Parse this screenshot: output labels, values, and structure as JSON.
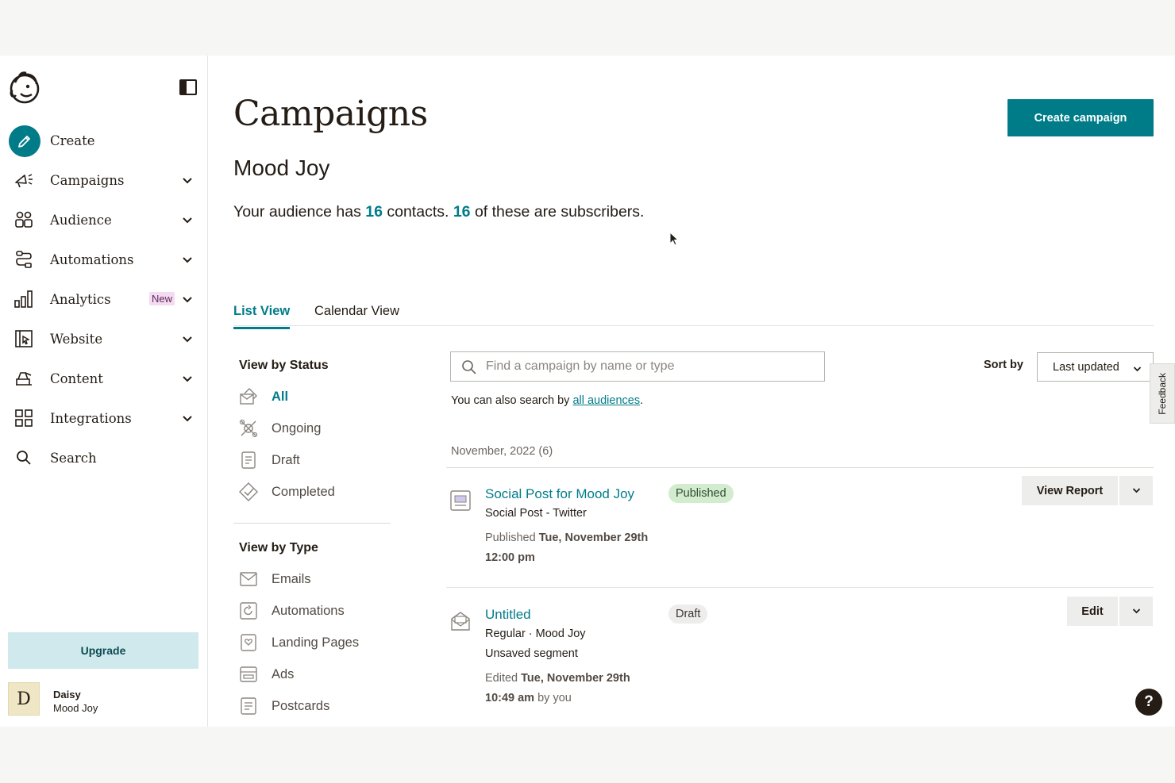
{
  "sidebar": {
    "items": [
      {
        "label": "Create",
        "icon": "pencil-icon"
      },
      {
        "label": "Campaigns",
        "icon": "megaphone-icon"
      },
      {
        "label": "Audience",
        "icon": "audience-icon"
      },
      {
        "label": "Automations",
        "icon": "automations-icon"
      },
      {
        "label": "Analytics",
        "icon": "bar-chart-icon",
        "badge": "New"
      },
      {
        "label": "Website",
        "icon": "website-icon"
      },
      {
        "label": "Content",
        "icon": "content-icon"
      },
      {
        "label": "Integrations",
        "icon": "grid-icon"
      },
      {
        "label": "Search",
        "icon": "search-icon"
      }
    ],
    "upgrade_label": "Upgrade",
    "profile": {
      "initial": "D",
      "name": "Daisy",
      "org": "Mood Joy"
    }
  },
  "header": {
    "title": "Campaigns",
    "create_label": "Create campaign",
    "audience_name": "Mood Joy",
    "summary": {
      "prefix": "Your audience has ",
      "contacts": "16",
      "middle": " contacts. ",
      "subscribers": "16",
      "suffix": " of these are subscribers."
    }
  },
  "tabs": [
    "List View",
    "Calendar View"
  ],
  "filters": {
    "status_heading": "View by Status",
    "status": [
      "All",
      "Ongoing",
      "Draft",
      "Completed"
    ],
    "type_heading": "View by Type",
    "types": [
      "Emails",
      "Automations",
      "Landing Pages",
      "Ads",
      "Postcards"
    ]
  },
  "search": {
    "placeholder": "Find a campaign by name or type",
    "hint_prefix": "You can also search by ",
    "hint_link": "all audiences",
    "hint_suffix": "."
  },
  "sort": {
    "label": "Sort by",
    "value": "Last updated"
  },
  "month_label": "November, 2022 (6)",
  "campaigns": [
    {
      "name": "Social Post for Mood Joy",
      "status": "Published",
      "line1": "Social Post - Twitter",
      "date_prefix": "Published ",
      "date": "Tue, November 29th",
      "time": "12:00 pm",
      "action": "View Report"
    },
    {
      "name": "Untitled",
      "status": "Draft",
      "line1": "Regular · Mood Joy",
      "line2": "Unsaved segment",
      "date_prefix": "Edited ",
      "date": "Tue, November 29th",
      "time": "10:49 am",
      "time_suffix": " by you",
      "action": "Edit"
    }
  ],
  "feedback_label": "Feedback",
  "help_label": "?",
  "colors": {
    "accent": "#007c89",
    "published": "#d3ecd0",
    "new_badge": "#f4dbf1",
    "upgrade": "#cfe9ec"
  }
}
